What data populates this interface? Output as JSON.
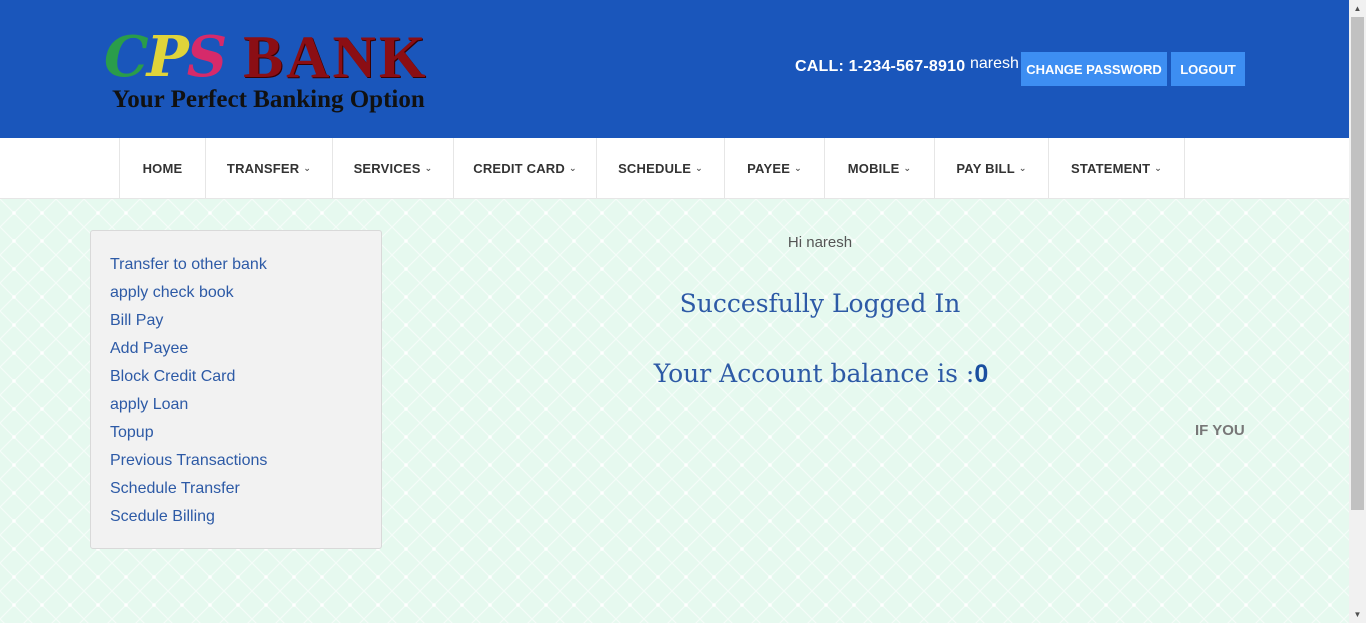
{
  "header": {
    "logo_letters": [
      "C",
      "P",
      "S"
    ],
    "logo_bank": "BANK",
    "logo_tagline": "Your Perfect Banking Option",
    "call": "CALL: 1-234-567-8910",
    "username": "naresh",
    "change_password": "CHANGE PASSWORD",
    "logout": "LOGOUT",
    "brand_color": "#1a56bb",
    "button_color": "#3d8ef2"
  },
  "nav": {
    "items": [
      {
        "label": "HOME",
        "dropdown": false
      },
      {
        "label": "TRANSFER",
        "dropdown": true
      },
      {
        "label": "SERVICES",
        "dropdown": true
      },
      {
        "label": "CREDIT CARD",
        "dropdown": true
      },
      {
        "label": "SCHEDULE",
        "dropdown": true
      },
      {
        "label": "PAYEE",
        "dropdown": true
      },
      {
        "label": "MOBILE",
        "dropdown": true
      },
      {
        "label": "PAY BILL",
        "dropdown": true
      },
      {
        "label": "STATEMENT",
        "dropdown": true
      }
    ],
    "caret_icon": "chevron-down-icon"
  },
  "sidebar": {
    "links": [
      "Transfer to other bank",
      "apply check book",
      "Bill Pay",
      "Add Payee",
      "Block Credit Card",
      "apply Loan",
      "Topup",
      "Previous Transactions",
      "Schedule Transfer",
      "Scedule Billing"
    ]
  },
  "main": {
    "greeting": "Hi naresh",
    "status": "Succesfully Logged In",
    "balance_label": "Your Account balance is :",
    "balance_value": "0",
    "marquee_text": "IF YOU"
  }
}
